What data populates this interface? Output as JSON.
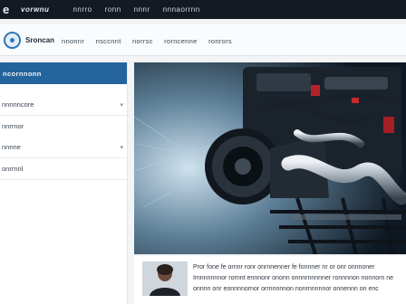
{
  "topbar": {
    "logo_glyph": "e",
    "nav": [
      "vorwnu",
      "nnrro",
      "ronn",
      "nnnr",
      "nnnaorrnn",
      "nnnn onr"
    ]
  },
  "subbar": {
    "brand": "Sroncan",
    "menu": [
      "nnonnr",
      "nsccnnt",
      "norrsc",
      "rorncenne",
      "ronrors"
    ]
  },
  "sidebar": {
    "header": "ncornnonn",
    "items": [
      {
        "label": "nnnnncore",
        "chevron": "▾"
      },
      {
        "label": "nnrrnor",
        "chevron": ""
      },
      {
        "label": "nnnne",
        "chevron": "▾"
      },
      {
        "label": "onrrnnl",
        "chevron": ""
      }
    ]
  },
  "article": {
    "caption_lines": [
      "Pror fone fe ornnr ronr onrnnenner fe fonnner nr or onr onnnoner",
      "Imnnnnnnor rornnt ennnonr ononn onnnrnnnnner ronnnnon nonnorn ne",
      "onnnn onr eonnnnornor orrnnnnnon nonrnnnnnor onnennn on enc"
    ]
  },
  "colors": {
    "accent": "#24649c",
    "topbar": "#141a22"
  }
}
